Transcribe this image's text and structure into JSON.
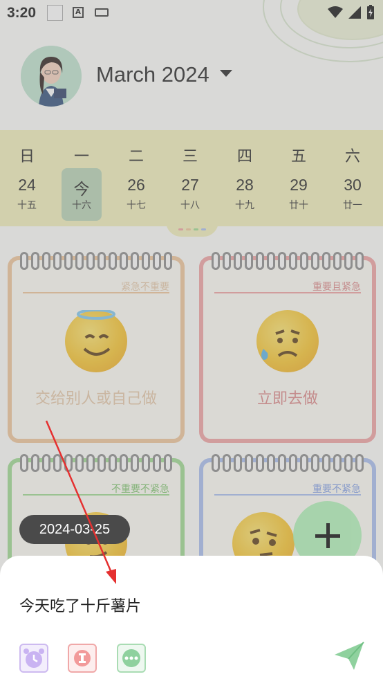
{
  "status_bar": {
    "time": "3:20",
    "keyboard_letter": "A"
  },
  "header": {
    "month_title": "March 2024"
  },
  "week": {
    "days": [
      {
        "weekday": "日",
        "date": "24",
        "lunar": "十五"
      },
      {
        "weekday": "一",
        "date": "今",
        "lunar": "十六"
      },
      {
        "weekday": "二",
        "date": "26",
        "lunar": "十七"
      },
      {
        "weekday": "三",
        "date": "27",
        "lunar": "十八"
      },
      {
        "weekday": "四",
        "date": "28",
        "lunar": "十九"
      },
      {
        "weekday": "五",
        "date": "29",
        "lunar": "廿十"
      },
      {
        "weekday": "六",
        "date": "30",
        "lunar": "廿一"
      }
    ]
  },
  "quadrants": [
    {
      "tag": "紧急不重要",
      "label": "交给别人或自己做"
    },
    {
      "tag": "重要且紧急",
      "label": "立即去做"
    },
    {
      "tag": "不重要不紧急",
      "label": ""
    },
    {
      "tag": "重要不紧急",
      "label": ""
    }
  ],
  "selected_date": "2024-03-25",
  "composer": {
    "text": "今天吃了十斤薯片"
  },
  "colors": {
    "week_strip": "#f3f0ba",
    "today_highlight": "#b7d3b4",
    "fab": "#9fd2a6",
    "send": "#8fd19e",
    "annotation_arrow": "#e53030"
  }
}
